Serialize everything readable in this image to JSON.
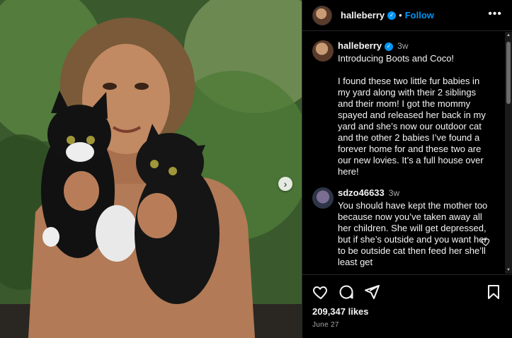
{
  "post": {
    "username": "halleberry",
    "follow_label": "Follow",
    "separator": "•",
    "caption_time": "3w",
    "caption": "Introducing Boots and Coco!\n\nI found these two little fur babies in my yard along with their 2 siblings and their mom! I got the mommy spayed and released her back in my yard and she’s now our outdoor cat and the other 2 babies I’ve found a forever home for and these two are our new lovies. It’s a full house over here!",
    "likes": "209,347 likes",
    "date": "June 27"
  },
  "comments": [
    {
      "author": "sdzo46633",
      "time": "3w",
      "text": "You should have kept the mother too because now you’ve taken away all her children. She will get depressed, but if she’s outside and you want her to be outside cat then feed her she’ll least get"
    }
  ],
  "icons": {
    "more": "more-options-icon",
    "verified": "verified-badge-icon",
    "next": "carousel-next-icon",
    "like": "heart-icon",
    "comment": "comment-icon",
    "share": "share-icon",
    "save": "bookmark-icon",
    "comment_like": "heart-icon"
  },
  "colors": {
    "accent": "#0095f6",
    "background": "#000000",
    "muted": "#a8a8a8"
  }
}
